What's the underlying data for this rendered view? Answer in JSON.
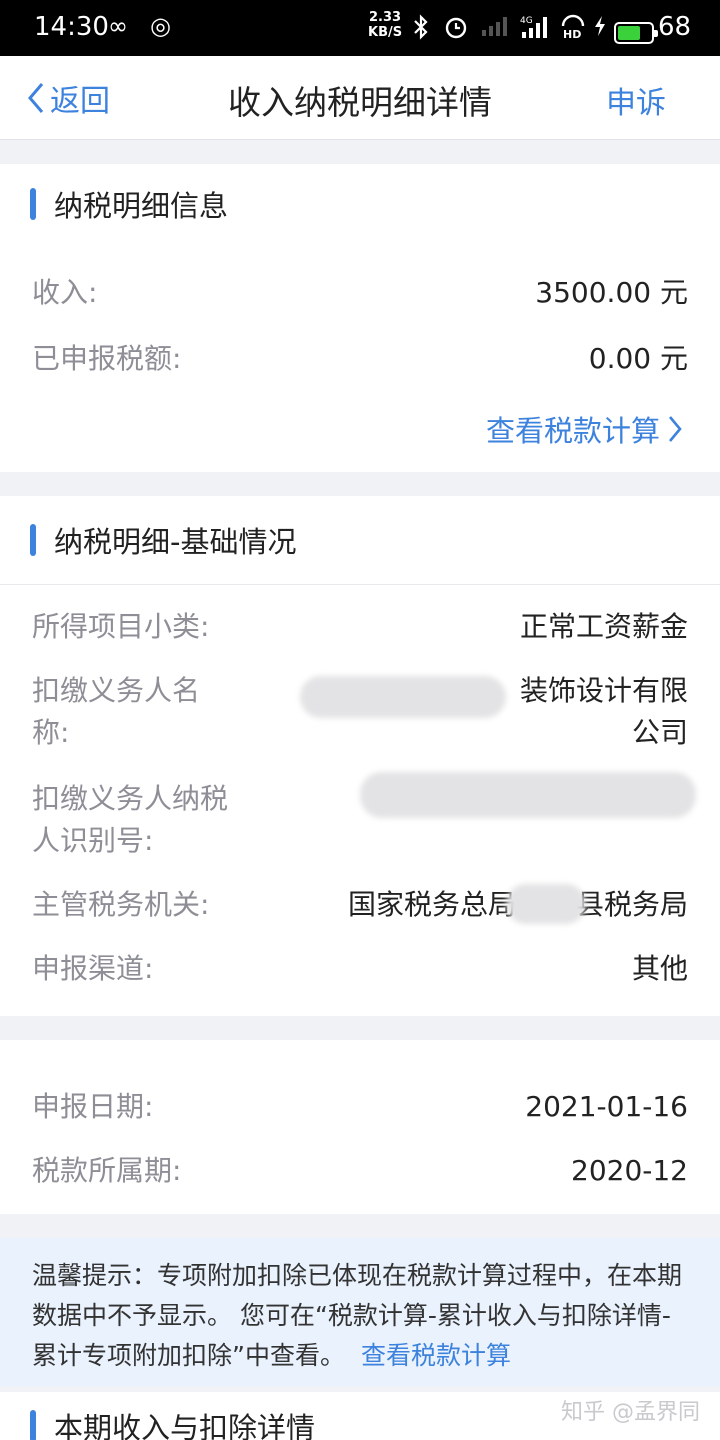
{
  "status_bar": {
    "time": "14:30",
    "speed_value": "2.33",
    "speed_unit": "KB/S",
    "battery_level": "68",
    "battery_fraction": 0.68,
    "icons": [
      "infinity-icon",
      "netease-icon",
      "bluetooth-icon",
      "alarm-icon",
      "signal-icon",
      "signal-4g-icon",
      "hd-icon",
      "charging-icon",
      "battery-icon"
    ]
  },
  "nav": {
    "back_label": "返回",
    "title": "收入纳税明细详情",
    "action_label": "申诉"
  },
  "section1": {
    "title": "纳税明细信息",
    "rows": [
      {
        "label": "收入:",
        "value": "3500.00 元"
      },
      {
        "label": "已申报税额:",
        "value": "0.00 元"
      }
    ],
    "link_label": "查看税款计算"
  },
  "section2": {
    "title": "纳税明细-基础情况",
    "item_type_label": "所得项目小类:",
    "item_type_value": "正常工资薪金",
    "withholder_name_label_1": "扣缴义务人名",
    "withholder_name_label_2": "称:",
    "withholder_name_value_1": "装饰设计有限",
    "withholder_name_value_2": "公司",
    "withholder_id_label_1": "扣缴义务人纳税",
    "withholder_id_label_2": "人识别号:",
    "tax_authority_label": "主管税务机关:",
    "tax_authority_value_1": "国家税务总局",
    "tax_authority_value_2": "县税务局",
    "channel_label": "申报渠道:",
    "channel_value": "其他"
  },
  "section3": {
    "rows": [
      {
        "label": "申报日期:",
        "value": "2021-01-16"
      },
      {
        "label": "税款所属期:",
        "value": "2020-12"
      }
    ]
  },
  "tip": {
    "text": "温馨提示：专项附加扣除已体现在税款计算过程中，在本期数据中不予显示。 您可在“税款计算-累计收入与扣除详情-累计专项附加扣除”中查看。",
    "link_label": "查看税款计算"
  },
  "section4": {
    "title": "本期收入与扣除详情"
  },
  "watermark": "知乎 @孟界同",
  "colors": {
    "accent": "#3d82dd",
    "tip_bg": "#e9f2fd",
    "label_gray": "#8e8e96"
  }
}
